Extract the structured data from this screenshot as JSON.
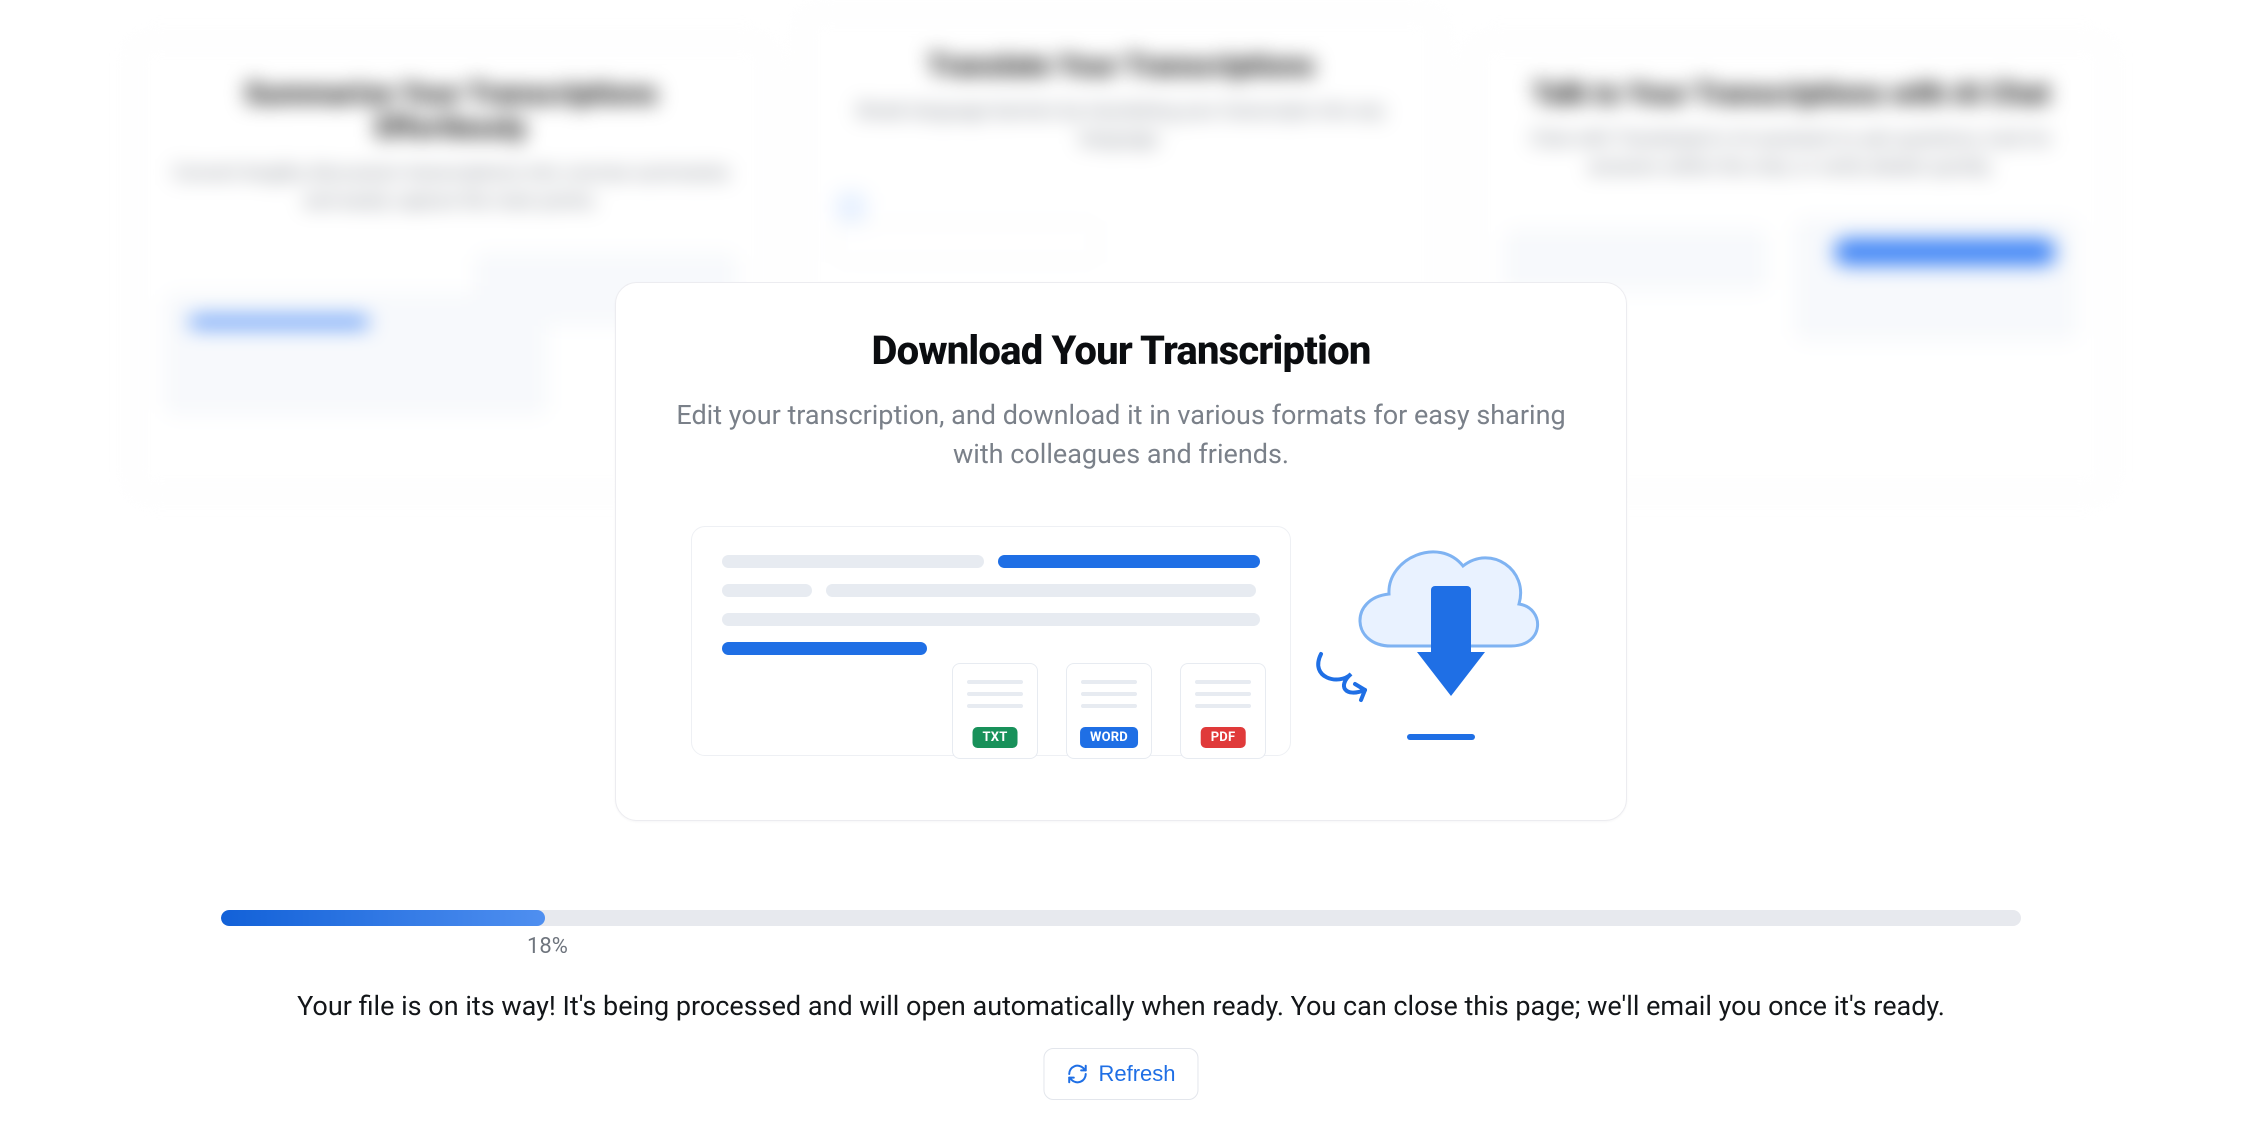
{
  "background": {
    "left": {
      "title": "Summarize Your Transcriptions Effortlessly",
      "subtitle": "Convert lengthy discussion transcriptions into concise summaries and easily capture the main points."
    },
    "center": {
      "title": "Translate Your Transcriptions",
      "subtitle": "Break language barriers by translating your transcripts into any language."
    },
    "right": {
      "title": "Talk to Your Transcriptions with AI Chat",
      "subtitle": "Chat with Transkriptor's AI assistant to ask questions, look for answers within the chat, or verify details quickly."
    }
  },
  "card": {
    "title": "Download Your Transcription",
    "description": "Edit your transcription, and download it in various formats for easy sharing with colleagues and friends.",
    "formats": {
      "txt": "TXT",
      "word": "WORD",
      "pdf": "PDF"
    }
  },
  "progress": {
    "percent": 18,
    "percent_label": "18%"
  },
  "status": {
    "message": "Your file is on its way! It's being processed and will open automatically when ready. You can close this page; we'll email you once it's ready."
  },
  "actions": {
    "refresh": "Refresh"
  }
}
